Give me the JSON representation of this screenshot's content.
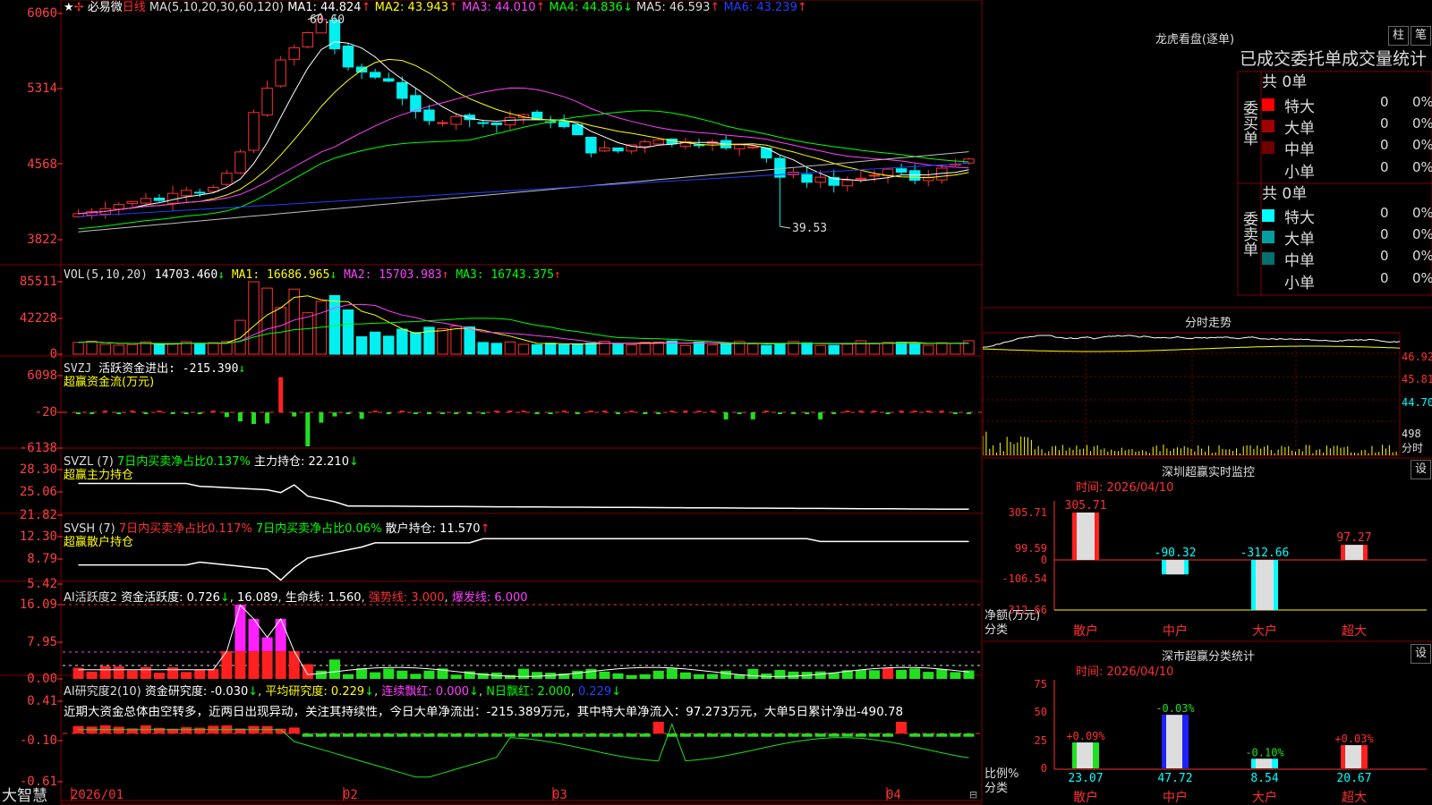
{
  "colors": {
    "up": "#ff3030",
    "down": "#00f0f0",
    "ma1": "#ffffff",
    "ma2": "#ffff00",
    "ma3": "#ff40ff",
    "ma4": "#00ff00",
    "ma5": "#c0c0c0",
    "ma6": "#2040ff",
    "grid": "#800000"
  },
  "main": {
    "title": "必易微",
    "period": "日线",
    "ma_label": "MA(5,10,20,30,60,120)",
    "ma": [
      {
        "name": "MA1:",
        "value": "44.824",
        "arrow": "↑"
      },
      {
        "name": "MA2:",
        "value": "43.943",
        "arrow": "↑"
      },
      {
        "name": "MA3:",
        "value": "44.010",
        "arrow": "↑"
      },
      {
        "name": "MA4:",
        "value": "44.836",
        "arrow": "↓"
      },
      {
        "name": "MA5:",
        "value": "46.593",
        "arrow": "↑"
      },
      {
        "name": "MA6:",
        "value": "43.239",
        "arrow": "↑"
      }
    ],
    "high_label": "60.60",
    "low_label": "39.53",
    "yaxis": [
      "6060",
      "5314",
      "4568",
      "3822"
    ],
    "xaxis": [
      "2026/01",
      "02",
      "03",
      "04"
    ]
  },
  "vol": {
    "label": "VOL(5,10,20)",
    "value": "14703.460",
    "arrow": "↓",
    "ma1": "MA1: 16686.965",
    "ma1_arrow": "↓",
    "ma2": "MA2: 15703.983",
    "ma2_arrow": "↑",
    "ma3": "MA3: 16743.375",
    "ma3_arrow": "↑",
    "yaxis": [
      "85511",
      "42228",
      "0"
    ]
  },
  "svzj": {
    "label": "SVZJ",
    "desc": "活跃资金进出: -215.390",
    "arrow": "↓",
    "sub": "超赢资金流(万元)",
    "yaxis": [
      "6098",
      "-20",
      "-6138"
    ]
  },
  "svzl": {
    "label": "SVZL (7)",
    "desc1": "7日内买卖净占比0.137%",
    "desc2": "主力持仓: 22.210",
    "arrow": "↓",
    "sub": "超赢主力持仓",
    "yaxis": [
      "28.30",
      "25.06",
      "21.82"
    ]
  },
  "svsh": {
    "label": "SVSH (7)",
    "desc1": "7日内买卖净占比0.117%",
    "desc2": "7日内买卖净占比0.06%",
    "desc3": "散户持仓: 11.570",
    "arrow": "↑",
    "sub": "超赢散户持仓",
    "yaxis": [
      "12.30",
      "8.79",
      "5.42"
    ]
  },
  "ai1": {
    "label": "AI活跃度2",
    "desc": "资金活跃度: 0.726",
    "arrow1": "↓",
    "v2": "16.089",
    "l3": "生命线: 1.560",
    "l4": "强势线: 3.000",
    "l5": "爆发线: 6.000",
    "yaxis": [
      "16.09",
      "7.95",
      "0.00"
    ]
  },
  "ai2": {
    "label": "AI研究度2(10)",
    "desc": "资金研究度: -0.030",
    "arrow1": "↓",
    "l2": "平均研究度: 0.229",
    "arrow2": "↓",
    "l3": "连续飘红: 0.000",
    "arrow3": "↓",
    "l4": "N日飘红: 2.000",
    "l5": "0.229",
    "arrow5": "↓",
    "note": "近期大资金总体由空转多，近两日出现异动，关注其持续性，今日大单净流出：-215.389万元，其中特大单净流入：97.273万元，大单5日累计净出-490.78",
    "yaxis": [
      "0.41",
      "-0.10",
      "-0.61"
    ]
  },
  "brand": "大智慧",
  "right": {
    "dragon_title": "龙虎看盘(逐单)",
    "btn1": "柱",
    "btn2": "笔",
    "stats_header": "已成交委托单成交量统计",
    "buy_label": "委买单",
    "buy_total": "共 0单",
    "sell_label": "委卖单",
    "sell_total": "共 0单",
    "rows_buy": [
      {
        "label": "特大",
        "count": "0",
        "pct": "0%",
        "color": "#ff0000"
      },
      {
        "label": "大单",
        "count": "0",
        "pct": "0%",
        "color": "#a00000"
      },
      {
        "label": "中单",
        "count": "0",
        "pct": "0%",
        "color": "#700000"
      },
      {
        "label": "小单",
        "count": "0",
        "pct": "0%",
        "color": ""
      }
    ],
    "rows_sell": [
      {
        "label": "特大",
        "count": "0",
        "pct": "0%",
        "color": "#00ffff"
      },
      {
        "label": "大单",
        "count": "0",
        "pct": "0%",
        "color": "#00a0a0"
      },
      {
        "label": "中单",
        "count": "0",
        "pct": "0%",
        "color": "#007070"
      },
      {
        "label": "小单",
        "count": "0",
        "pct": "0%",
        "color": ""
      }
    ],
    "intraday_title": "分时走势",
    "intraday_y": [
      "46.92",
      "45.81",
      "44.70"
    ],
    "intraday_vol": "498",
    "intraday_unit": "分时",
    "monitor_title": "深圳超赢实时监控",
    "monitor_time": "时间: 2026/04/10",
    "monitor_y": [
      "305.71",
      "99.59",
      "0",
      "-106.54",
      "-312.66"
    ],
    "monitor_bars": [
      {
        "cat": "散户",
        "value": 305.71,
        "label": "305.71"
      },
      {
        "cat": "中户",
        "value": -90.32,
        "label": "-90.32"
      },
      {
        "cat": "大户",
        "value": -312.66,
        "label": "-312.66"
      },
      {
        "cat": "超大",
        "value": 97.27,
        "label": "97.27"
      }
    ],
    "monitor_ylabel": "净额(万元)",
    "monitor_xlabel": "分类",
    "set": "设",
    "class_title": "深市超赢分类统计",
    "class_time": "时间: 2026/04/10",
    "class_y": [
      "75",
      "50",
      "25",
      "0"
    ],
    "class_bars": [
      {
        "cat": "散户",
        "value": 23.07,
        "delta": "+0.09%",
        "color": "#20e020"
      },
      {
        "cat": "中户",
        "value": 47.72,
        "delta": "-0.03%",
        "color": "#2020ff"
      },
      {
        "cat": "大户",
        "value": 8.54,
        "delta": "-0.10%",
        "color": "#00ffff"
      },
      {
        "cat": "超大",
        "value": 20.67,
        "delta": "+0.03%",
        "color": "#ff2020"
      }
    ],
    "class_ylabel": "比例%",
    "class_xlabel": "分类"
  },
  "chart_data": [
    {
      "type": "candlestick",
      "title": "必易微 日线",
      "yrange": [
        38.22,
        60.6
      ],
      "high": 60.6,
      "low": 39.53,
      "closes": [
        40.8,
        41.0,
        41.3,
        41.7,
        42.0,
        42.3,
        42.1,
        42.8,
        43.1,
        42.9,
        43.4,
        44.8,
        46.9,
        50.8,
        53.2,
        56.0,
        57.2,
        58.7,
        60.0,
        57.1,
        55.3,
        54.8,
        54.3,
        53.9,
        52.2,
        50.9,
        50.0,
        49.8,
        50.4,
        50.1,
        49.8,
        49.6,
        50.3,
        50.6,
        50.1,
        49.8,
        49.4,
        48.6,
        46.8,
        47.3,
        47.0,
        47.6,
        47.9,
        48.1,
        47.7,
        47.9,
        47.6,
        47.9,
        47.3,
        47.6,
        47.4,
        46.3,
        44.4,
        44.9,
        43.9,
        44.4,
        43.6,
        44.1,
        44.3,
        44.6,
        45.2,
        44.9,
        44.1,
        44.4,
        45.3,
        45.7,
        46.2
      ],
      "ma": [
        "MA1",
        "MA2",
        "MA3",
        "MA4",
        "MA5",
        "MA6"
      ]
    },
    {
      "type": "bar",
      "title": "VOL(5,10,20)",
      "yrange": [
        0,
        85511
      ]
    },
    {
      "type": "bar",
      "title": "超赢资金流(万元)",
      "yrange": [
        -6138,
        6098
      ]
    },
    {
      "type": "line",
      "title": "超赢主力持仓",
      "yrange": [
        21.82,
        28.3
      ]
    },
    {
      "type": "line",
      "title": "超赢散户持仓",
      "yrange": [
        5.42,
        12.3
      ]
    },
    {
      "type": "bar",
      "title": "AI活跃度2",
      "yrange": [
        0,
        16.09
      ]
    },
    {
      "type": "bar",
      "title": "AI研究度2(10)",
      "yrange": [
        -0.61,
        0.41
      ]
    },
    {
      "type": "bar",
      "title": "深圳超赢实时监控",
      "categories": [
        "散户",
        "中户",
        "大户",
        "超大"
      ],
      "values": [
        305.71,
        -90.32,
        -312.66,
        97.27
      ]
    },
    {
      "type": "bar",
      "title": "深市超赢分类统计",
      "categories": [
        "散户",
        "中户",
        "大户",
        "超大"
      ],
      "values": [
        23.07,
        47.72,
        8.54,
        20.67
      ]
    }
  ]
}
